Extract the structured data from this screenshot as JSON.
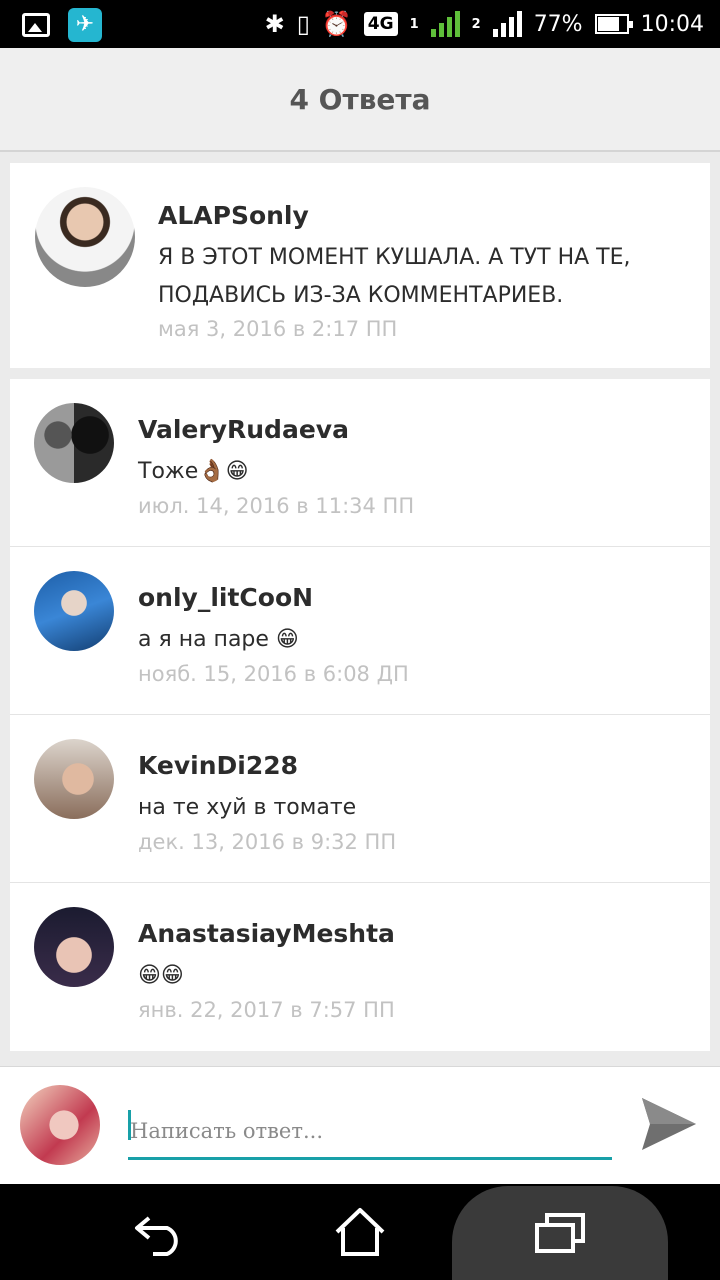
{
  "status_bar": {
    "icons": [
      "gallery-icon",
      "app-icon",
      "bluetooth-icon",
      "vibrate-icon",
      "alarm-icon",
      "network-4g-icon",
      "signal-sim1-icon",
      "signal-sim2-icon",
      "battery-icon"
    ],
    "network": "4G",
    "sim1": "1",
    "sim2": "2",
    "battery": "77%",
    "time": "10:04"
  },
  "header": {
    "title": "4 Ответа"
  },
  "main_comment": {
    "username": "ALAPSonly",
    "text": "Я В ЭТОТ МОМЕНТ КУШАЛА. А ТУТ НА ТЕ, ПОДАВИСЬ ИЗ-ЗА КОММЕНТАРИЕВ.",
    "date": "мая 3, 2016 в 2:17 ПП"
  },
  "replies": [
    {
      "username": "ValeryRudaeva",
      "text": "Тоже👌🏾😁",
      "date": "июл. 14, 2016 в 11:34 ПП"
    },
    {
      "username": "only_litCooN",
      "text": "а я на паре 😁",
      "date": "нояб. 15, 2016 в 6:08 ДП"
    },
    {
      "username": "KevinDi228",
      "text": "на те хуй в томате",
      "date": "дек. 13, 2016 в 9:32 ПП"
    },
    {
      "username": "AnastasiayMeshta",
      "text": "😁😁",
      "date": "янв. 22, 2017 в 7:57 ПП"
    }
  ],
  "composer": {
    "placeholder": "Написать ответ..."
  },
  "colors": {
    "accent": "#18a0a8",
    "date_text": "#c2c2c2",
    "username": "#2c2c2c"
  }
}
